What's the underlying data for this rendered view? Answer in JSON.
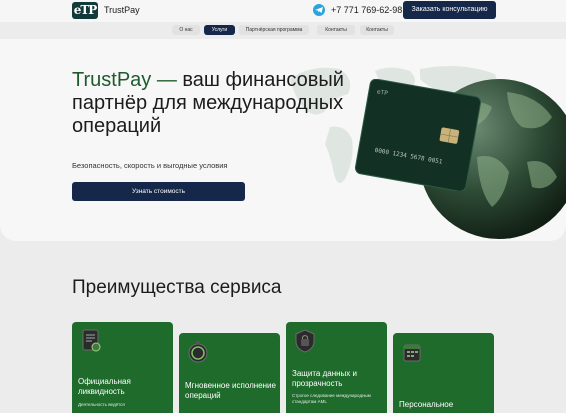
{
  "header": {
    "logo_mark": "eTP",
    "brand": "TrustPay",
    "phone": "+7 771 769-62-98",
    "cta_label": "Заказать консультацию",
    "icons": {
      "messenger": "telegram-icon"
    }
  },
  "nav": {
    "items": [
      {
        "label": "О нас",
        "active": false
      },
      {
        "label": "Услуги",
        "active": true
      },
      {
        "label": "Партнёрская программа",
        "active": false
      },
      {
        "label": "Контакты",
        "active": false
      },
      {
        "label": "Контакты",
        "active": false
      }
    ]
  },
  "hero": {
    "title_brand": "TrustPay —",
    "title_rest": "ваш финансовый партнёр для международных операций",
    "subtitle": "Безопасность, скорость и выгодные условия",
    "cta_label": "Узнать стоимость",
    "card_number": "0000 1234 5678 0051"
  },
  "advantages": {
    "title": "Преимущества сервиса",
    "items": [
      {
        "label": "Официальная ликвидность",
        "desc": "Деятельность ведётся",
        "icon": "document-icon"
      },
      {
        "label": "Мгновенное исполнение операций",
        "desc": "",
        "icon": "stopwatch-icon"
      },
      {
        "label": "Защита данных и прозрачность",
        "desc": "Строгое следование международным стандартам AML",
        "icon": "lock-icon"
      },
      {
        "label": "Персональное",
        "desc": "",
        "icon": "calendar-icon"
      }
    ]
  },
  "colors": {
    "accent_navy": "#16284a",
    "brand_green": "#1e5a2e",
    "card_green": "#1f6b2c"
  }
}
